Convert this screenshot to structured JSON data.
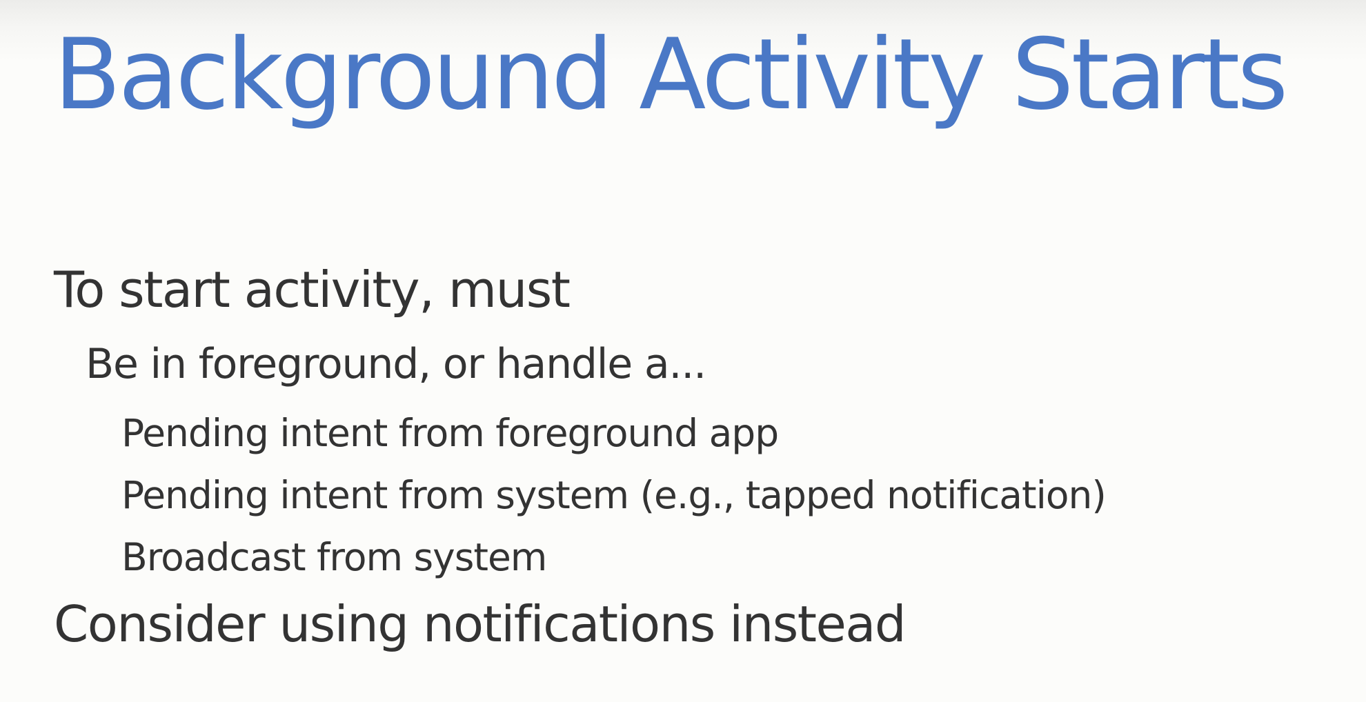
{
  "slide": {
    "title": "Background Activity Starts",
    "bullets": [
      {
        "level": 1,
        "text": "To start activity, must"
      },
      {
        "level": 2,
        "text": "Be in foreground, or handle a..."
      },
      {
        "level": 3,
        "text": "Pending intent from foreground app"
      },
      {
        "level": 3,
        "text": "Pending intent from system (e.g., tapped notification)"
      },
      {
        "level": 3,
        "text": "Broadcast from system"
      },
      {
        "level": 1,
        "text": "Consider using notifications instead"
      }
    ]
  },
  "colors": {
    "title": "#4a78c6",
    "body_text": "#333333",
    "background": "#fcfcfa"
  }
}
